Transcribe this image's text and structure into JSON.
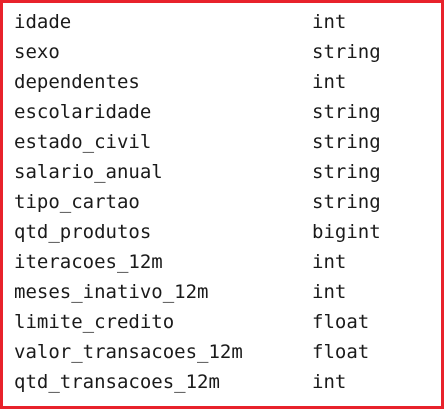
{
  "accent_color": "#e8222b",
  "schema": {
    "columns": [
      {
        "name": "idade",
        "type": "int"
      },
      {
        "name": "sexo",
        "type": "string"
      },
      {
        "name": "dependentes",
        "type": "int"
      },
      {
        "name": "escolaridade",
        "type": "string"
      },
      {
        "name": "estado_civil",
        "type": "string"
      },
      {
        "name": "salario_anual",
        "type": "string"
      },
      {
        "name": "tipo_cartao",
        "type": "string"
      },
      {
        "name": "qtd_produtos",
        "type": "bigint"
      },
      {
        "name": "iteracoes_12m",
        "type": "int"
      },
      {
        "name": "meses_inativo_12m",
        "type": "int"
      },
      {
        "name": "limite_credito",
        "type": "float"
      },
      {
        "name": "valor_transacoes_12m",
        "type": "float"
      },
      {
        "name": "qtd_transacoes_12m",
        "type": "int"
      }
    ]
  }
}
